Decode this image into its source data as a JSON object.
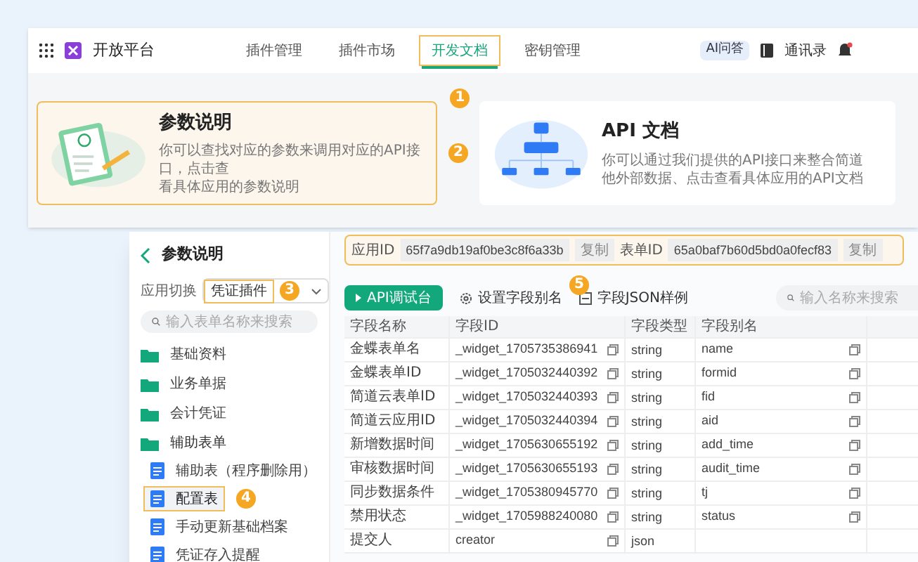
{
  "nav": {
    "app_title": "开放平台",
    "tabs": [
      {
        "label": "插件管理",
        "selected": false
      },
      {
        "label": "插件市场",
        "selected": false
      },
      {
        "label": "开发文档",
        "selected": true
      },
      {
        "label": "密钥管理",
        "selected": false
      }
    ],
    "tab_callout": "1",
    "ai_badge": "AI问答",
    "contacts": "通讯录"
  },
  "cards": [
    {
      "title": "参数说明",
      "lines": [
        "你可以查找对应的参数来调用对应的API接口，点击查",
        "看具体应用的参数说明"
      ],
      "selected": true,
      "callout": "2"
    },
    {
      "title": "API 文档",
      "lines": [
        "你可以通过我们提供的API接口来整合简道",
        "他外部数据、点击查看具体应用的API文档"
      ],
      "selected": false
    }
  ],
  "panel": {
    "title": "参数说明",
    "switch_label": "应用切换",
    "switch_value": "凭证插件",
    "switch_callout": "3",
    "search_placeholder": "输入表单名称来搜索",
    "tree": [
      {
        "label": "基础资料",
        "expanded": false
      },
      {
        "label": "业务单据",
        "expanded": false
      },
      {
        "label": "会计凭证",
        "expanded": false
      },
      {
        "label": "辅助表单",
        "expanded": true,
        "children": [
          {
            "label": "辅助表（程序删除用）",
            "selected": false
          },
          {
            "label": "配置表",
            "selected": true,
            "callout": "4"
          },
          {
            "label": "手动更新基础档案",
            "selected": false
          },
          {
            "label": "凭证存入提醒",
            "selected": false
          }
        ]
      }
    ]
  },
  "ids": [
    {
      "label": "应用ID",
      "value": "65f7a9db19af0be3c8f6a33b",
      "action": "复制"
    },
    {
      "label": "表单ID",
      "value": "65a0baf7b60d5bd0a0fecf83",
      "action": "复制"
    }
  ],
  "ids_callout": "5",
  "toolbar": {
    "primary": "API调试台",
    "alias": "设置字段别名",
    "json": "字段JSON样例",
    "search_placeholder": "输入名称来搜索"
  },
  "table": {
    "columns": [
      "字段名称",
      "字段ID",
      "字段类型",
      "字段别名"
    ],
    "rows": [
      [
        "金蝶表单名",
        "_widget_1705735386941",
        "string",
        "name"
      ],
      [
        "金蝶表单ID",
        "_widget_1705032440392",
        "string",
        "formid"
      ],
      [
        "简道云表单ID",
        "_widget_1705032440393",
        "string",
        "fid"
      ],
      [
        "简道云应用ID",
        "_widget_1705032440394",
        "string",
        "aid"
      ],
      [
        "新增数据时间",
        "_widget_1705630655192",
        "string",
        "add_time"
      ],
      [
        "审核数据时间",
        "_widget_1705630655193",
        "string",
        "audit_time"
      ],
      [
        "同步数据条件",
        "_widget_1705380945770",
        "string",
        "tj"
      ],
      [
        "禁用状态",
        "_widget_1705988240080",
        "string",
        "status"
      ],
      [
        "提交人",
        "creator",
        "json",
        ""
      ]
    ]
  }
}
